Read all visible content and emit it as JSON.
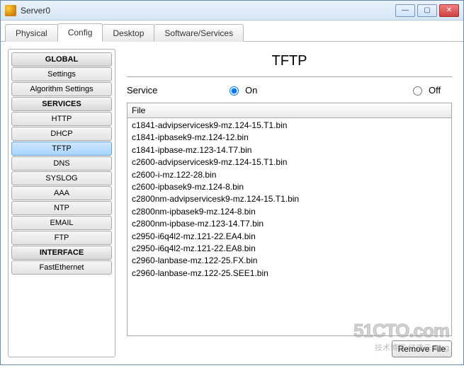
{
  "window": {
    "title": "Server0",
    "btn_min": "—",
    "btn_max": "▢",
    "btn_close": "✕"
  },
  "tabs": {
    "physical": "Physical",
    "config": "Config",
    "desktop": "Desktop",
    "software": "Software/Services"
  },
  "sidebar": {
    "h_global": "GLOBAL",
    "settings": "Settings",
    "algo": "Algorithm Settings",
    "h_services": "SERVICES",
    "http": "HTTP",
    "dhcp": "DHCP",
    "tftp": "TFTP",
    "dns": "DNS",
    "syslog": "SYSLOG",
    "aaa": "AAA",
    "ntp": "NTP",
    "email": "EMAIL",
    "ftp": "FTP",
    "h_interface": "INTERFACE",
    "fe": "FastEthernet"
  },
  "service": {
    "title": "TFTP",
    "label": "Service",
    "on": "On",
    "off": "Off",
    "on_checked": true
  },
  "filebox": {
    "header": "File",
    "remove": "Remove File",
    "files": [
      "c1841-advipservicesk9-mz.124-15.T1.bin",
      "c1841-ipbasek9-mz.124-12.bin",
      "c1841-ipbase-mz.123-14.T7.bin",
      "c2600-advipservicesk9-mz.124-15.T1.bin",
      "c2600-i-mz.122-28.bin",
      "c2600-ipbasek9-mz.124-8.bin",
      "c2800nm-advipservicesk9-mz.124-15.T1.bin",
      "c2800nm-ipbasek9-mz.124-8.bin",
      "c2800nm-ipbase-mz.123-14.T7.bin",
      "c2950-i6q4l2-mz.121-22.EA4.bin",
      "c2950-i6q4l2-mz.121-22.EA8.bin",
      "c2960-lanbase-mz.122-25.FX.bin",
      "c2960-lanbase-mz.122-25.SEE1.bin"
    ]
  },
  "watermark": {
    "big": "51CTO.com",
    "small": "技术博客   亿速云   Blog"
  }
}
